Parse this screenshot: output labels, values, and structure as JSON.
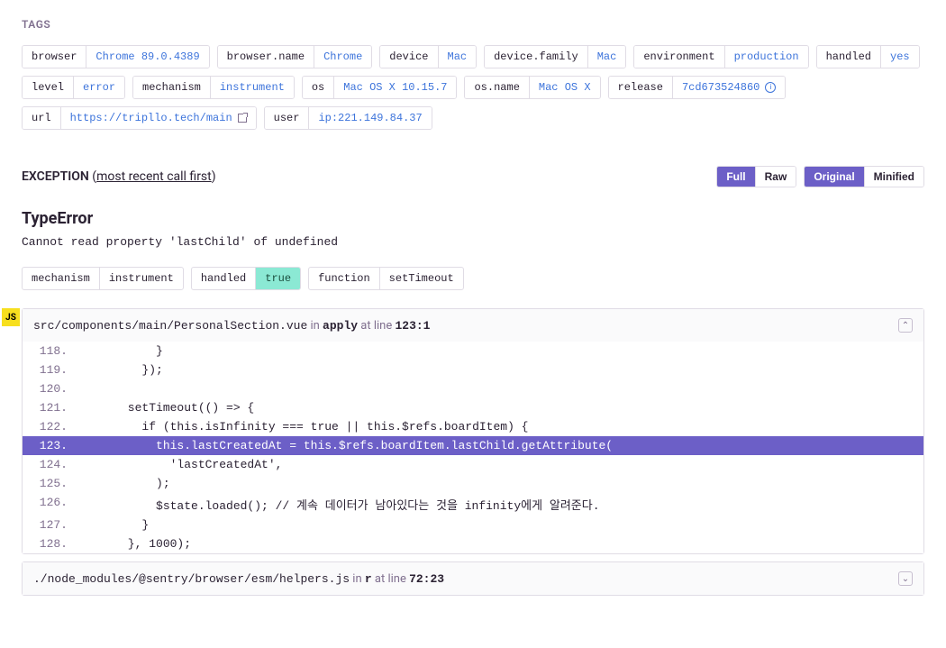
{
  "tags_header": "TAGS",
  "tags": [
    {
      "key": "browser",
      "value": "Chrome 89.0.4389"
    },
    {
      "key": "browser.name",
      "value": "Chrome"
    },
    {
      "key": "device",
      "value": "Mac"
    },
    {
      "key": "device.family",
      "value": "Mac"
    },
    {
      "key": "environment",
      "value": "production"
    },
    {
      "key": "handled",
      "value": "yes"
    },
    {
      "key": "level",
      "value": "error"
    },
    {
      "key": "mechanism",
      "value": "instrument"
    },
    {
      "key": "os",
      "value": "Mac OS X 10.15.7"
    },
    {
      "key": "os.name",
      "value": "Mac OS X"
    },
    {
      "key": "release",
      "value": "7cd673524860",
      "has_info": true
    },
    {
      "key": "url",
      "value": "https://tripllo.tech/main",
      "has_ext": true
    },
    {
      "key": "user",
      "value": "ip:221.149.84.37"
    }
  ],
  "exception": {
    "label": "EXCEPTION",
    "paren_open": "(",
    "order_text": "most recent call first",
    "paren_close": ")",
    "toggles": {
      "view": {
        "full": "Full",
        "raw": "Raw"
      },
      "source": {
        "original": "Original",
        "minified": "Minified"
      }
    },
    "error_type": "TypeError",
    "error_msg": "Cannot read property 'lastChild' of undefined"
  },
  "meta": [
    {
      "key": "mechanism",
      "value": "instrument",
      "highlight": false
    },
    {
      "key": "handled",
      "value": "true",
      "highlight": true
    },
    {
      "key": "function",
      "value": "setTimeout",
      "highlight": false
    }
  ],
  "js_badge": "JS",
  "frames": [
    {
      "file": "src/components/main/PersonalSection.vue",
      "in_text": " in ",
      "fn": "apply",
      "at_line_text": " at line ",
      "line": "123:1",
      "expanded": true,
      "code": [
        {
          "num": "118.",
          "text": "          }"
        },
        {
          "num": "119.",
          "text": "        });"
        },
        {
          "num": "120.",
          "text": ""
        },
        {
          "num": "121.",
          "text": "      setTimeout(() => {"
        },
        {
          "num": "122.",
          "text": "        if (this.isInfinity === true || this.$refs.boardItem) {"
        },
        {
          "num": "123.",
          "text": "          this.lastCreatedAt = this.$refs.boardItem.lastChild.getAttribute(",
          "hl": true
        },
        {
          "num": "124.",
          "text": "            'lastCreatedAt',"
        },
        {
          "num": "125.",
          "text": "          );"
        },
        {
          "num": "126.",
          "text": "          $state.loaded(); // 계속 데이터가 남아있다는 것을 infinity에게 알려준다."
        },
        {
          "num": "127.",
          "text": "        }"
        },
        {
          "num": "128.",
          "text": "      }, 1000);"
        }
      ]
    },
    {
      "file": "./node_modules/@sentry/browser/esm/helpers.js",
      "in_text": " in ",
      "fn": "r",
      "at_line_text": " at line ",
      "line": "72:23",
      "expanded": false
    }
  ]
}
